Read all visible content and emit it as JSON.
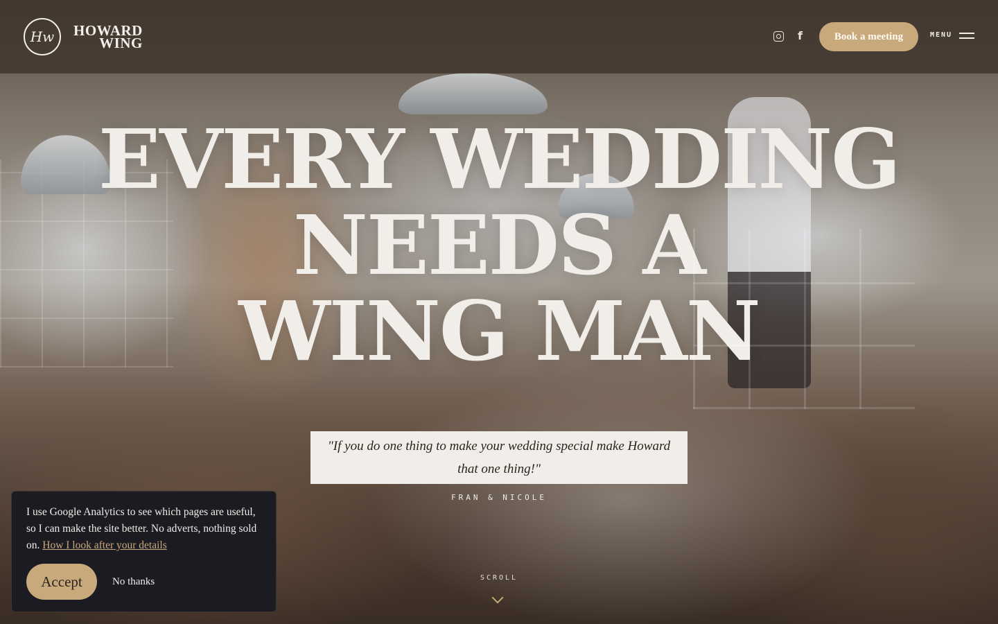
{
  "header": {
    "logo_monogram": "Hw",
    "logo_line1": "HOWARD",
    "logo_line2": "WING",
    "social_instagram": "instagram-icon",
    "social_facebook": "f",
    "book_button": "Book a meeting",
    "menu_label": "MENU"
  },
  "hero": {
    "headline_line1": "EVERY WEDDING",
    "headline_line2": "NEEDS A",
    "headline_line3": "WING MAN",
    "quote": "\"If you do one thing to make your wedding special make Howard that one thing!\"",
    "attribution": "FRAN & NICOLE",
    "scroll_label": "SCROLL"
  },
  "cookie": {
    "text": "I use Google Analytics to see which pages are useful, so I can make the site better. No adverts, nothing sold on.",
    "link": "How I look after your details",
    "accept": "Accept",
    "decline": "No thanks"
  },
  "colors": {
    "accent": "#c8a97c",
    "cookie_bg": "#1c1b22",
    "text_light": "#f1ede8"
  }
}
